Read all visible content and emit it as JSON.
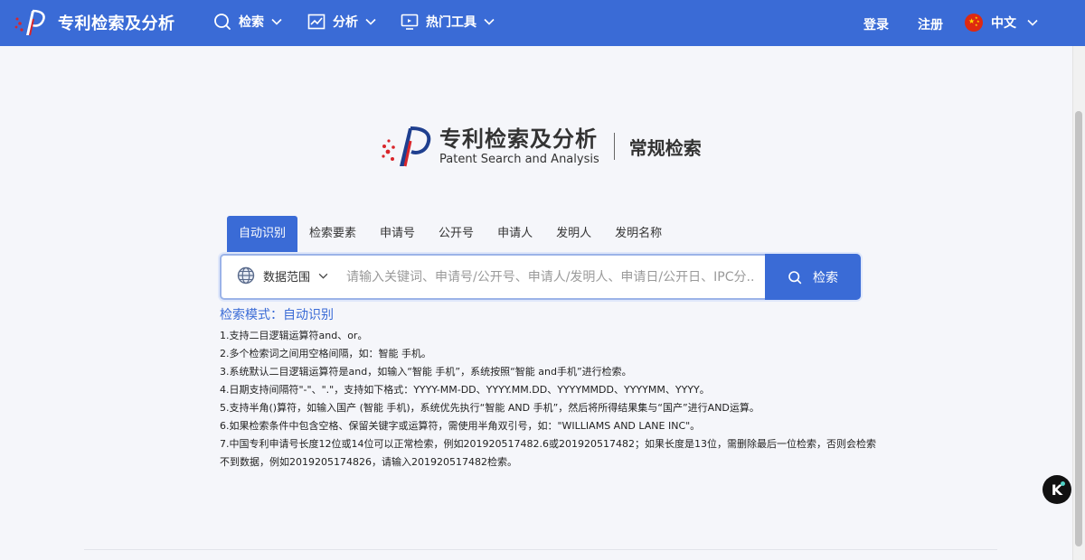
{
  "header": {
    "brand_title": "专利检索及分析",
    "nav": [
      {
        "label": "检索",
        "icon": "search-icon"
      },
      {
        "label": "分析",
        "icon": "chart-icon"
      },
      {
        "label": "热门工具",
        "icon": "monitor-icon"
      }
    ],
    "login_label": "登录",
    "register_label": "注册",
    "language_label": "中文",
    "language_flag": "china-flag-icon"
  },
  "hero": {
    "logo_cn": "专利检索及分析",
    "logo_en": "Patent Search and Analysis",
    "mode_title": "常规检索"
  },
  "tabs": [
    {
      "label": "自动识别",
      "active": true
    },
    {
      "label": "检索要素",
      "active": false
    },
    {
      "label": "申请号",
      "active": false
    },
    {
      "label": "公开号",
      "active": false
    },
    {
      "label": "申请人",
      "active": false
    },
    {
      "label": "发明人",
      "active": false
    },
    {
      "label": "发明名称",
      "active": false
    }
  ],
  "search": {
    "scope_label": "数据范围",
    "placeholder": "请输入关键词、申请号/公开号、申请人/发明人、申请日/公开日、IPC分...",
    "value": "",
    "button_label": "检索"
  },
  "help": {
    "title": "检索模式：自动识别",
    "lines": [
      "1.支持二目逻辑运算符and、or。",
      "2.多个检索词之间用空格间隔，如：智能 手机。",
      "3.系统默认二目逻辑运算符是and，如输入“智能 手机”，系统按照“智能 and手机”进行检索。",
      "4.日期支持间隔符\"-\"、\".\"，支持如下格式：YYYY-MM-DD、YYYY.MM.DD、YYYYMMDD、YYYYMM、YYYY。",
      "5.支持半角()算符，如输入国产 (智能 手机)，系统优先执行“智能 AND 手机”，然后将所得结果集与“国产”进行AND运算。",
      "6.如果检索条件中包含空格、保留关键字或运算符，需使用半角双引号，如：\"WILLIAMS AND LANE INC\"。",
      "7.中国专利申请号长度12位或14位可以正常检索，例如201920517482.6或201920517482；如果长度是13位，需删除最后一位检索，否则会检索",
      "不到数据，例如2019205174826，请输入201920517482检索。"
    ]
  },
  "floating_button_label": "K",
  "colors": {
    "primary": "#3a6bd6",
    "background": "#f5f6fa",
    "logo_red": "#d9252a",
    "logo_blue": "#1f3f8f"
  }
}
